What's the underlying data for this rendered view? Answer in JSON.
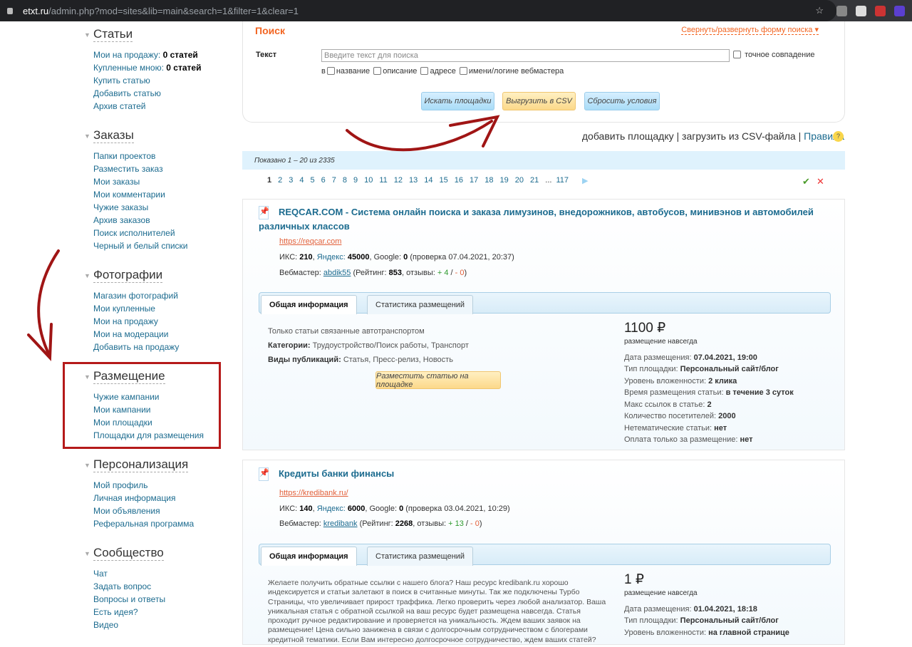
{
  "browser": {
    "url_host": "etxt.ru",
    "url_rest": "/admin.php?mod=sites&lib=main&search=1&filter=1&clear=1"
  },
  "sidebar": [
    {
      "title": "Статьи",
      "items": [
        {
          "label": "Мои на продажу:",
          "bold": "0 статей"
        },
        {
          "label": "Купленные мною:",
          "bold": "0 статей"
        },
        {
          "label": "Купить статью"
        },
        {
          "label": "Добавить статью"
        },
        {
          "label": "Архив статей"
        }
      ]
    },
    {
      "title": "Заказы",
      "items": [
        {
          "label": "Папки проектов"
        },
        {
          "label": "Разместить заказ"
        },
        {
          "label": "Мои заказы"
        },
        {
          "label": "Мои комментарии"
        },
        {
          "label": "Чужие заказы"
        },
        {
          "label": "Архив заказов"
        },
        {
          "label": "Поиск исполнителей"
        },
        {
          "label": "Черный и белый списки"
        }
      ]
    },
    {
      "title": "Фотографии",
      "items": [
        {
          "label": "Магазин фотографий"
        },
        {
          "label": "Мои купленные"
        },
        {
          "label": "Мои на продажу"
        },
        {
          "label": "Мои на модерации"
        },
        {
          "label": "Добавить на продажу"
        }
      ]
    },
    {
      "title": "Размещение",
      "items": [
        {
          "label": "Чужие кампании"
        },
        {
          "label": "Мои кампании"
        },
        {
          "label": "Мои площадки"
        },
        {
          "label": "Площадки для размещения"
        }
      ]
    },
    {
      "title": "Персонализация",
      "items": [
        {
          "label": "Мой профиль"
        },
        {
          "label": "Личная информация"
        },
        {
          "label": "Мои объявления"
        },
        {
          "label": "Реферальная программа"
        }
      ]
    },
    {
      "title": "Сообщество",
      "items": [
        {
          "label": "Чат"
        },
        {
          "label": "Задать вопрос"
        },
        {
          "label": "Вопросы и ответы"
        },
        {
          "label": "Есть идея?"
        },
        {
          "label": "Видео"
        }
      ]
    }
  ],
  "search": {
    "title": "Поиск",
    "toggle": "Свернуть/развернуть форму поиска ▾",
    "text_label": "Текст",
    "placeholder": "Введите текст для поиска",
    "exact": "точное совпадение",
    "in": "в",
    "opt_name": "название",
    "opt_desc": "описание",
    "opt_addr": "адресе",
    "opt_login": "имени/логине вебмастера",
    "btn_search": "Искать площадки",
    "btn_csv": "Выгрузить в CSV",
    "btn_reset": "Сбросить условия"
  },
  "links": {
    "add": "добавить площадку",
    "upload": "загрузить из CSV-файла",
    "rules": "Правила",
    "help": "?"
  },
  "shown": "Показано 1 – 20 из 2335",
  "pager": {
    "current": "1",
    "pages": [
      "2",
      "3",
      "4",
      "5",
      "6",
      "7",
      "8",
      "9",
      "10",
      "11",
      "12",
      "13",
      "14",
      "15",
      "16",
      "17",
      "18",
      "19",
      "20",
      "21"
    ],
    "ellipsis": "...",
    "last": "117"
  },
  "tabs": {
    "general": "Общая информация",
    "stats": "Статистика размещений"
  },
  "labels": {
    "iks": "ИКС:",
    "yandex": "Яндекс:",
    "google": "Google:",
    "check": "проверка",
    "webmaster": "Вебмастер:",
    "rating": "Рейтинг:",
    "reviews": "отзывы:",
    "forever": "размещение навсегда",
    "date": "Дата размещения:",
    "type": "Тип площадки:",
    "level": "Уровень вложенности:",
    "time": "Время размещения статьи:",
    "maxlinks": "Макс ссылок в статье:",
    "visitors": "Количество посетителей:",
    "offtopic": "Нетематические статьи:",
    "payonly": "Оплата только за размещение:",
    "categories": "Категории:",
    "pubtypes": "Виды публикаций:",
    "place_btn": "Разместить статью на площадке"
  },
  "sites": [
    {
      "title": "REQCAR.COM - Система онлайн поиска и заказа лимузинов, внедорожников, автобусов, минивэнов и автомобилей различных классов",
      "url": "https://reqcar.com",
      "iks": "210",
      "yandex": "45000",
      "google": "0",
      "checked": "07.04.2021, 20:37",
      "webmaster": "abdik55",
      "rating": "853",
      "plus": "+ 4",
      "minus": "- 0",
      "description": "Только статьи связанные автотранспортом",
      "categories": "Трудоустройство/Поиск работы, Транспорт",
      "pubtypes": "Статья, Пресс-релиз, Новость",
      "price": "1100 ₽",
      "date": "07.04.2021, 19:00",
      "type": "Персональный сайт/блог",
      "level": "2 клика",
      "time": "в течение 3 суток",
      "maxlinks": "2",
      "visitors": "2000",
      "offtopic": "нет",
      "payonly": "нет"
    },
    {
      "title": "Кредиты банки финансы",
      "url": "https://kredibank.ru/",
      "iks": "140",
      "yandex": "6000",
      "google": "0",
      "checked": "03.04.2021, 10:29",
      "webmaster": "kredibank",
      "rating": "2268",
      "plus": "+ 13",
      "minus": "- 0",
      "description": "Желаете получить обратные ссылки с нашего блога? Наш ресурс kredibank.ru хорошо индексируется и статьи залетают в поиск в считанные минуты. Так же подключены Турбо Страницы, что увеличивает прирост траффика. Легко проверить через любой анализатор. Ваша уникальная статья с обратной ссылкой на ваш ресурс будет размещена навсегда. Статья проходит ручное редактирование и проверяется на уникальность. Ждем ваших заявок на размещение! Цена сильно занижена в связи с долгосрочным сотрудничеством с блогерами кредитной тематики. Если Вам интересно долгосрочное сотрудничество, ждем ваших статей?",
      "price": "1 ₽",
      "date": "01.04.2021, 18:18",
      "type": "Персональный сайт/блог",
      "level": "на главной странице"
    }
  ]
}
